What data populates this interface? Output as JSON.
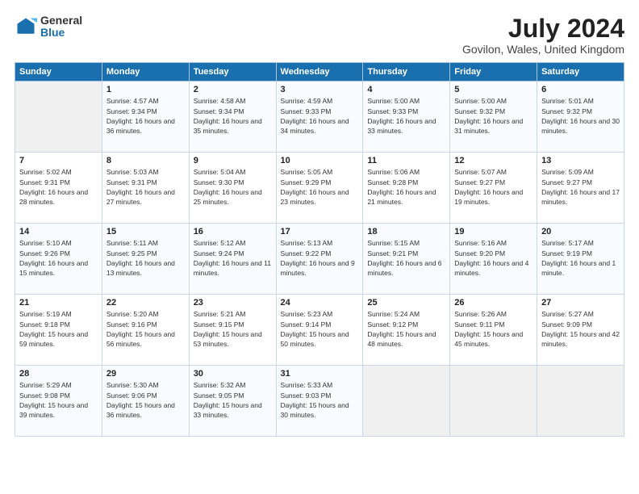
{
  "header": {
    "logo_general": "General",
    "logo_blue": "Blue",
    "title": "July 2024",
    "subtitle": "Govilon, Wales, United Kingdom"
  },
  "calendar": {
    "weekdays": [
      "Sunday",
      "Monday",
      "Tuesday",
      "Wednesday",
      "Thursday",
      "Friday",
      "Saturday"
    ],
    "weeks": [
      [
        {
          "day": null
        },
        {
          "day": "1",
          "sunrise": "Sunrise: 4:57 AM",
          "sunset": "Sunset: 9:34 PM",
          "daylight": "Daylight: 16 hours and 36 minutes."
        },
        {
          "day": "2",
          "sunrise": "Sunrise: 4:58 AM",
          "sunset": "Sunset: 9:34 PM",
          "daylight": "Daylight: 16 hours and 35 minutes."
        },
        {
          "day": "3",
          "sunrise": "Sunrise: 4:59 AM",
          "sunset": "Sunset: 9:33 PM",
          "daylight": "Daylight: 16 hours and 34 minutes."
        },
        {
          "day": "4",
          "sunrise": "Sunrise: 5:00 AM",
          "sunset": "Sunset: 9:33 PM",
          "daylight": "Daylight: 16 hours and 33 minutes."
        },
        {
          "day": "5",
          "sunrise": "Sunrise: 5:00 AM",
          "sunset": "Sunset: 9:32 PM",
          "daylight": "Daylight: 16 hours and 31 minutes."
        },
        {
          "day": "6",
          "sunrise": "Sunrise: 5:01 AM",
          "sunset": "Sunset: 9:32 PM",
          "daylight": "Daylight: 16 hours and 30 minutes."
        }
      ],
      [
        {
          "day": "7",
          "sunrise": "Sunrise: 5:02 AM",
          "sunset": "Sunset: 9:31 PM",
          "daylight": "Daylight: 16 hours and 28 minutes."
        },
        {
          "day": "8",
          "sunrise": "Sunrise: 5:03 AM",
          "sunset": "Sunset: 9:31 PM",
          "daylight": "Daylight: 16 hours and 27 minutes."
        },
        {
          "day": "9",
          "sunrise": "Sunrise: 5:04 AM",
          "sunset": "Sunset: 9:30 PM",
          "daylight": "Daylight: 16 hours and 25 minutes."
        },
        {
          "day": "10",
          "sunrise": "Sunrise: 5:05 AM",
          "sunset": "Sunset: 9:29 PM",
          "daylight": "Daylight: 16 hours and 23 minutes."
        },
        {
          "day": "11",
          "sunrise": "Sunrise: 5:06 AM",
          "sunset": "Sunset: 9:28 PM",
          "daylight": "Daylight: 16 hours and 21 minutes."
        },
        {
          "day": "12",
          "sunrise": "Sunrise: 5:07 AM",
          "sunset": "Sunset: 9:27 PM",
          "daylight": "Daylight: 16 hours and 19 minutes."
        },
        {
          "day": "13",
          "sunrise": "Sunrise: 5:09 AM",
          "sunset": "Sunset: 9:27 PM",
          "daylight": "Daylight: 16 hours and 17 minutes."
        }
      ],
      [
        {
          "day": "14",
          "sunrise": "Sunrise: 5:10 AM",
          "sunset": "Sunset: 9:26 PM",
          "daylight": "Daylight: 16 hours and 15 minutes."
        },
        {
          "day": "15",
          "sunrise": "Sunrise: 5:11 AM",
          "sunset": "Sunset: 9:25 PM",
          "daylight": "Daylight: 16 hours and 13 minutes."
        },
        {
          "day": "16",
          "sunrise": "Sunrise: 5:12 AM",
          "sunset": "Sunset: 9:24 PM",
          "daylight": "Daylight: 16 hours and 11 minutes."
        },
        {
          "day": "17",
          "sunrise": "Sunrise: 5:13 AM",
          "sunset": "Sunset: 9:22 PM",
          "daylight": "Daylight: 16 hours and 9 minutes."
        },
        {
          "day": "18",
          "sunrise": "Sunrise: 5:15 AM",
          "sunset": "Sunset: 9:21 PM",
          "daylight": "Daylight: 16 hours and 6 minutes."
        },
        {
          "day": "19",
          "sunrise": "Sunrise: 5:16 AM",
          "sunset": "Sunset: 9:20 PM",
          "daylight": "Daylight: 16 hours and 4 minutes."
        },
        {
          "day": "20",
          "sunrise": "Sunrise: 5:17 AM",
          "sunset": "Sunset: 9:19 PM",
          "daylight": "Daylight: 16 hours and 1 minute."
        }
      ],
      [
        {
          "day": "21",
          "sunrise": "Sunrise: 5:19 AM",
          "sunset": "Sunset: 9:18 PM",
          "daylight": "Daylight: 15 hours and 59 minutes."
        },
        {
          "day": "22",
          "sunrise": "Sunrise: 5:20 AM",
          "sunset": "Sunset: 9:16 PM",
          "daylight": "Daylight: 15 hours and 56 minutes."
        },
        {
          "day": "23",
          "sunrise": "Sunrise: 5:21 AM",
          "sunset": "Sunset: 9:15 PM",
          "daylight": "Daylight: 15 hours and 53 minutes."
        },
        {
          "day": "24",
          "sunrise": "Sunrise: 5:23 AM",
          "sunset": "Sunset: 9:14 PM",
          "daylight": "Daylight: 15 hours and 50 minutes."
        },
        {
          "day": "25",
          "sunrise": "Sunrise: 5:24 AM",
          "sunset": "Sunset: 9:12 PM",
          "daylight": "Daylight: 15 hours and 48 minutes."
        },
        {
          "day": "26",
          "sunrise": "Sunrise: 5:26 AM",
          "sunset": "Sunset: 9:11 PM",
          "daylight": "Daylight: 15 hours and 45 minutes."
        },
        {
          "day": "27",
          "sunrise": "Sunrise: 5:27 AM",
          "sunset": "Sunset: 9:09 PM",
          "daylight": "Daylight: 15 hours and 42 minutes."
        }
      ],
      [
        {
          "day": "28",
          "sunrise": "Sunrise: 5:29 AM",
          "sunset": "Sunset: 9:08 PM",
          "daylight": "Daylight: 15 hours and 39 minutes."
        },
        {
          "day": "29",
          "sunrise": "Sunrise: 5:30 AM",
          "sunset": "Sunset: 9:06 PM",
          "daylight": "Daylight: 15 hours and 36 minutes."
        },
        {
          "day": "30",
          "sunrise": "Sunrise: 5:32 AM",
          "sunset": "Sunset: 9:05 PM",
          "daylight": "Daylight: 15 hours and 33 minutes."
        },
        {
          "day": "31",
          "sunrise": "Sunrise: 5:33 AM",
          "sunset": "Sunset: 9:03 PM",
          "daylight": "Daylight: 15 hours and 30 minutes."
        },
        {
          "day": null
        },
        {
          "day": null
        },
        {
          "day": null
        }
      ]
    ]
  }
}
